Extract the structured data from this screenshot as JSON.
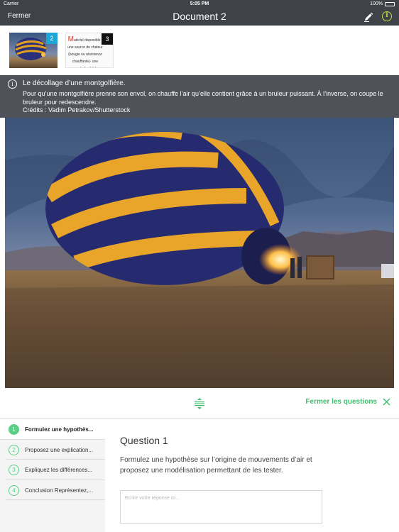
{
  "status_bar": {
    "carrier": "Carrier",
    "time": "5:05 PM",
    "battery": "100%"
  },
  "nav": {
    "close_label": "Fermer",
    "title": "Document 2"
  },
  "thumbnails": [
    {
      "badge": "2"
    },
    {
      "badge": "3",
      "first_letter": "M",
      "text": "atériel disponible : une source de chaleur (bougie ou résistance chauffante)- une source de froid (glaç..."
    }
  ],
  "caption": {
    "heading": "Le décollage d’une montgolfière.",
    "body": "Pour qu’une montgolfière prenne son envol, on chauffe l’air qu’elle contient grâce à un bruleur puissant. À l’inverse, on coupe le bruleur pour redescendre.",
    "credits": "Crédits : Vadim Petrakov/Shutterstock"
  },
  "questions_toggle": {
    "label": "Fermer les questions"
  },
  "questions": [
    {
      "number": "1",
      "label": "Formulez une hypothès..."
    },
    {
      "number": "2",
      "label": "Proposez une explication..."
    },
    {
      "number": "3",
      "label": "Expliquez les différences..."
    },
    {
      "number": "4",
      "label": "Conclusion Représentez,..."
    }
  ],
  "question_detail": {
    "title": "Question 1",
    "text": "Formulez une hypothèse sur l’origine de mouvements d’air et proposez une modélisation permettant de les tester.",
    "answer_placeholder": "Ecrire votre réponse ici..."
  },
  "colors": {
    "navbar": "#3f4348",
    "accent_green": "#3fbf6f",
    "info_yellow": "#c3d94a",
    "badge_blue": "#1aa7d8"
  }
}
